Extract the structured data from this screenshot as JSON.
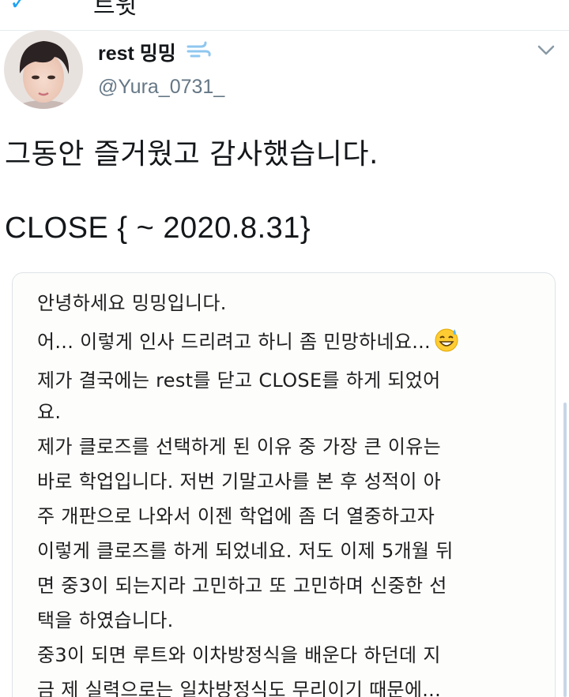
{
  "topbar": {
    "back_icon": "back-arrow-icon",
    "title": "트윗"
  },
  "tweet": {
    "display_name": "rest 밍밍",
    "name_emoji": "dash-emoji-icon",
    "handle": "@Yura_0731_",
    "menu_icon": "chevron-down-icon",
    "lines": [
      "그동안 즐거웠고 감사했습니다.",
      "CLOSE { ~ 2020.8.31}"
    ]
  },
  "note": {
    "lines": [
      "안녕하세요 밍밍입니다.",
      "어... 이렇게 인사 드리려고 하니 좀 민망하네요...",
      "제가 결국에는 rest를 닫고 CLOSE를 하게 되었어",
      "요.",
      "제가 클로즈를 선택하게 된 이유 중 가장 큰 이유는",
      "바로 학업입니다. 저번 기말고사를 본 후 성적이 아",
      "주 개판으로 나와서 이젠 학업에 좀 더 열중하고자",
      "이렇게 클로즈를 하게 되었네요. 저도 이제 5개월 뒤",
      "면 중3이 되는지라 고민하고 또 고민하며 신중한 선",
      "택을 하였습니다.",
      "중3이 되면 루트와 이차방정식을 배운다 하던데 지",
      "금 제 실력으로는 일차방정식도 무리이기 때문에..."
    ],
    "inline_emoji": "sweat-smile-emoji-icon"
  },
  "colors": {
    "accent": "#1da1f2",
    "handle": "#657786",
    "text": "#14171a"
  }
}
